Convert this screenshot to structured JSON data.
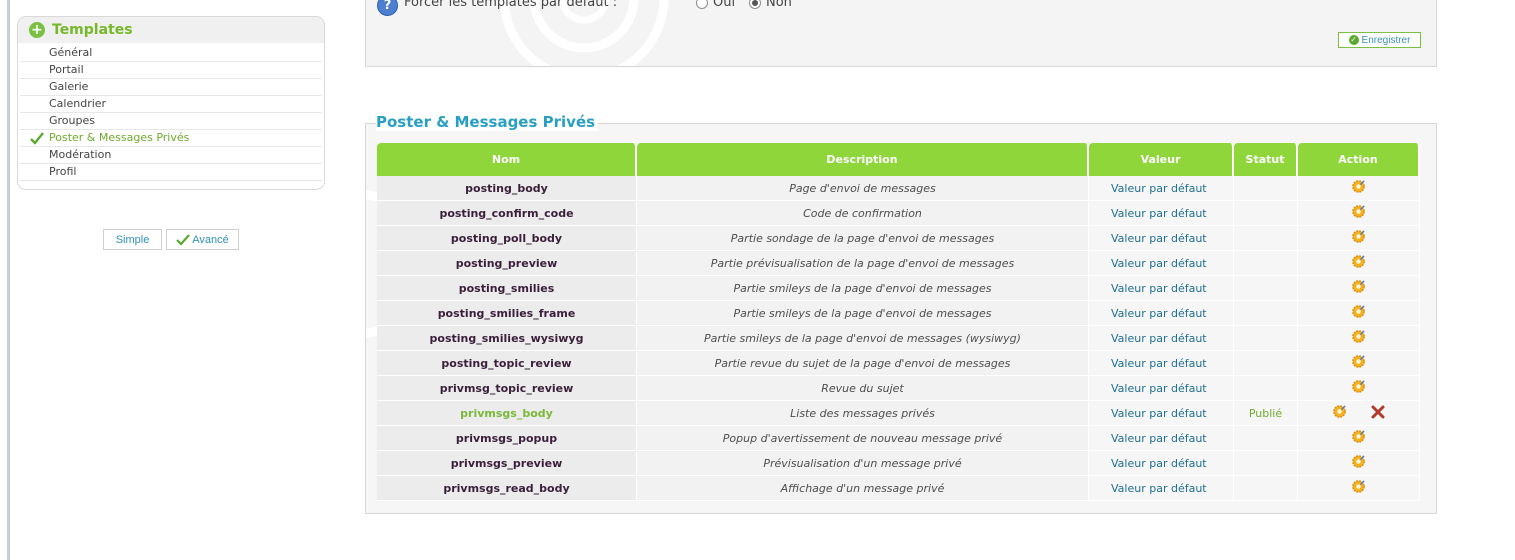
{
  "sidebar": {
    "title": "Templates",
    "items": [
      {
        "label": "Général",
        "active": false
      },
      {
        "label": "Portail",
        "active": false
      },
      {
        "label": "Galerie",
        "active": false
      },
      {
        "label": "Calendrier",
        "active": false
      },
      {
        "label": "Groupes",
        "active": false
      },
      {
        "label": "Poster & Messages Privés",
        "active": true
      },
      {
        "label": "Modération",
        "active": false
      },
      {
        "label": "Profil",
        "active": false
      }
    ],
    "mode_simple": "Simple",
    "mode_advanced": "Avancé"
  },
  "top_panel": {
    "force_label": "Forcer les templates par défaut :",
    "option_yes": "Oui",
    "option_no": "Non",
    "selected": "Non",
    "save_label": "Enregistrer"
  },
  "section": {
    "title": "Poster & Messages Privés",
    "headers": {
      "name": "Nom",
      "description": "Description",
      "value": "Valeur",
      "status": "Statut",
      "action": "Action"
    },
    "rows": [
      {
        "name": "posting_body",
        "description": "Page d'envoi de messages",
        "value": "Valeur par défaut",
        "status": "",
        "deletable": false
      },
      {
        "name": "posting_confirm_code",
        "description": "Code de confirmation",
        "value": "Valeur par défaut",
        "status": "",
        "deletable": false
      },
      {
        "name": "posting_poll_body",
        "description": "Partie sondage de la page d'envoi de messages",
        "value": "Valeur par défaut",
        "status": "",
        "deletable": false
      },
      {
        "name": "posting_preview",
        "description": "Partie prévisualisation de la page d'envoi de messages",
        "value": "Valeur par défaut",
        "status": "",
        "deletable": false
      },
      {
        "name": "posting_smilies",
        "description": "Partie smileys de la page d'envoi de messages",
        "value": "Valeur par défaut",
        "status": "",
        "deletable": false
      },
      {
        "name": "posting_smilies_frame",
        "description": "Partie smileys de la page d'envoi de messages",
        "value": "Valeur par défaut",
        "status": "",
        "deletable": false
      },
      {
        "name": "posting_smilies_wysiwyg",
        "description": "Partie smileys de la page d'envoi de messages (wysiwyg)",
        "value": "Valeur par défaut",
        "status": "",
        "deletable": false
      },
      {
        "name": "posting_topic_review",
        "description": "Partie revue du sujet de la page d'envoi de messages",
        "value": "Valeur par défaut",
        "status": "",
        "deletable": false
      },
      {
        "name": "privmsg_topic_review",
        "description": "Revue du sujet",
        "value": "Valeur par défaut",
        "status": "",
        "deletable": false
      },
      {
        "name": "privmsgs_body",
        "description": "Liste des messages privés",
        "value": "Valeur par défaut",
        "status": "Publié",
        "deletable": true
      },
      {
        "name": "privmsgs_popup",
        "description": "Popup d'avertissement de nouveau message privé",
        "value": "Valeur par défaut",
        "status": "",
        "deletable": false
      },
      {
        "name": "privmsgs_preview",
        "description": "Prévisualisation d'un message privé",
        "value": "Valeur par défaut",
        "status": "",
        "deletable": false
      },
      {
        "name": "privmsgs_read_body",
        "description": "Affichage d'un message privé",
        "value": "Valeur par défaut",
        "status": "",
        "deletable": false
      }
    ]
  },
  "icons": {
    "sidebar_header": "plus-circle-icon",
    "active_item": "check-icon",
    "help": "question-mark-icon",
    "save": "check-circle-icon",
    "edit": "gear-edit-icon",
    "delete": "red-x-icon"
  },
  "colors": {
    "accent_green": "#8ed63a",
    "title_blue": "#2a9fc4",
    "link_teal": "#1f6f8f",
    "status_green": "#6eaa2c",
    "delete_red": "#b33a2a"
  }
}
